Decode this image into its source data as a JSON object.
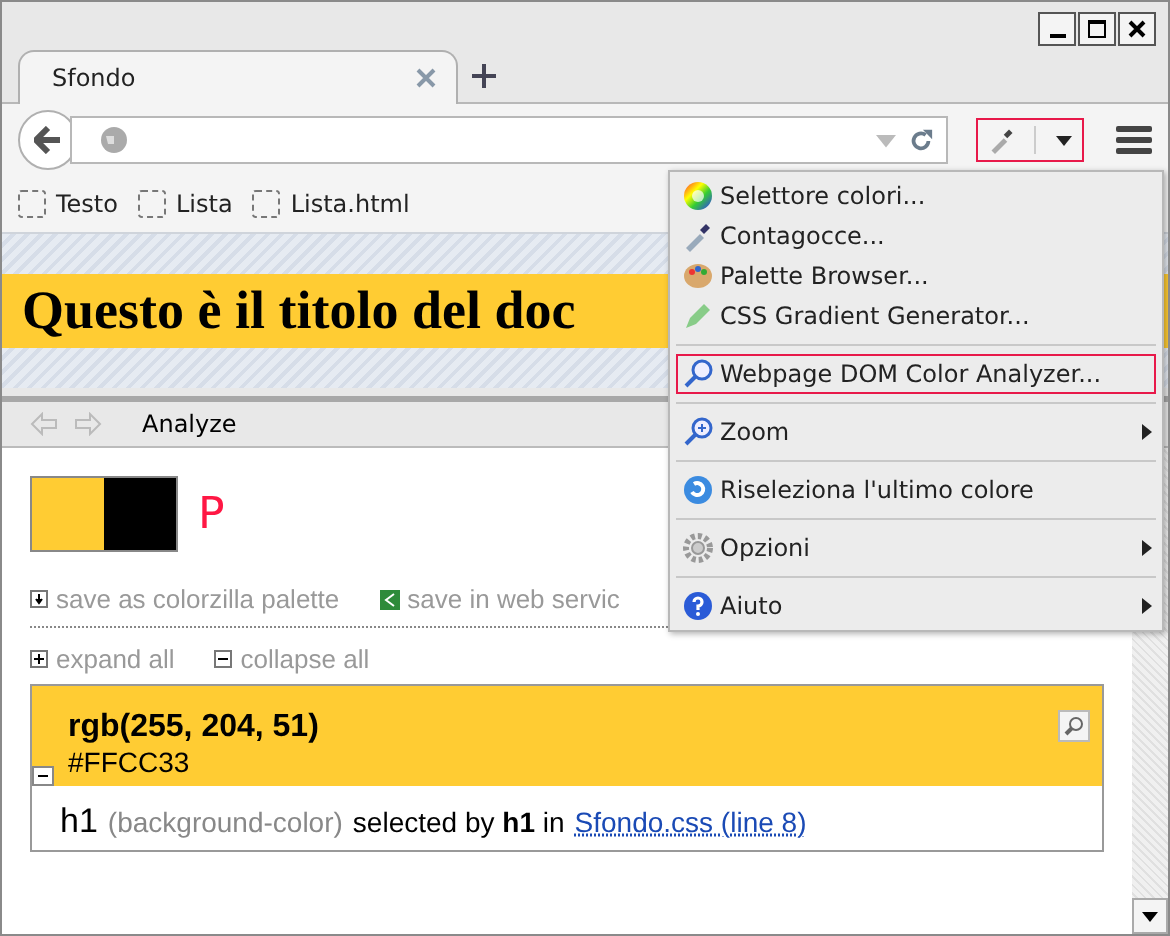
{
  "tab": {
    "title": "Sfondo",
    "selected": true
  },
  "toolbar": {
    "colorzilla_highlighted": true
  },
  "bookmarks": [
    "Testo",
    "Lista",
    "Lista.html"
  ],
  "page": {
    "heading": "Questo è il titolo del doc"
  },
  "panel": {
    "toolbar_label": "Analyze",
    "swatches": [
      {
        "color": "#ffcc33"
      },
      {
        "color": "#000000"
      }
    ],
    "marker": "P",
    "actions": [
      "save as colorzilla palette",
      "save in web servic"
    ],
    "links": [
      "expand all",
      "collapse all"
    ],
    "card": {
      "color": "#ffcc33",
      "rgb": "rgb(255, 204, 51)",
      "hex": "#FFCC33",
      "expanded": true,
      "selector": "h1",
      "property": "(background-color)",
      "middle": "selected by **h1** in",
      "source": "Sfondo.css (line 8)"
    }
  },
  "menu": {
    "groups": [
      [
        {
          "label": "Selettore colori...",
          "submenu": false,
          "highlighted": false
        },
        {
          "label": "Contagocce...",
          "submenu": false,
          "highlighted": false
        },
        {
          "label": "Palette Browser...",
          "submenu": false,
          "highlighted": false
        },
        {
          "label": "CSS Gradient Generator...",
          "submenu": false,
          "highlighted": false
        }
      ],
      [
        {
          "label": "Webpage DOM Color Analyzer...",
          "submenu": false,
          "highlighted": true
        }
      ],
      [
        {
          "label": "Zoom",
          "submenu": true,
          "highlighted": false
        }
      ],
      [
        {
          "label": "Riseleziona l'ultimo colore",
          "submenu": false,
          "highlighted": false
        }
      ],
      [
        {
          "label": "Opzioni",
          "submenu": true,
          "highlighted": false
        }
      ],
      [
        {
          "label": "Aiuto",
          "submenu": true,
          "highlighted": false
        }
      ]
    ]
  }
}
